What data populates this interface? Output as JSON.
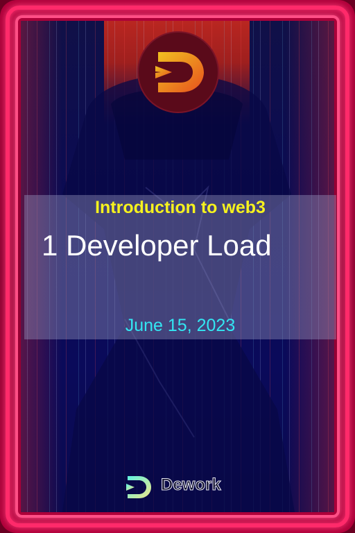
{
  "card": {
    "title": "Introduction to web3",
    "headline": "1 Developer Load",
    "date": "June 15, 2023",
    "brand_name": "Dework"
  },
  "icons": {
    "top_logo": "dework-logo-icon",
    "brand_logo": "dework-logo-icon"
  },
  "colors": {
    "frame": "#ff2a6a",
    "title": "#f6f21e",
    "headline": "#ffffff",
    "date": "#33e6f2",
    "background": "#0b0b52"
  }
}
